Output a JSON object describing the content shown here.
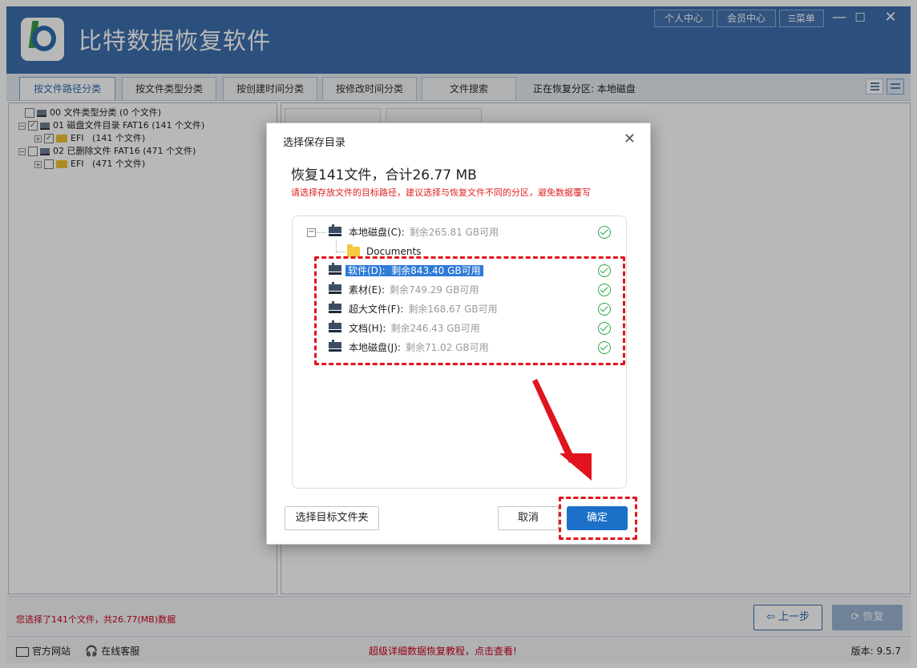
{
  "app": {
    "title": "比特数据恢复软件",
    "top_buttons": [
      "个人中心",
      "会员中心",
      "菜单"
    ],
    "brand_color": "#3d6fae"
  },
  "tabs": [
    {
      "label": "按文件路径分类",
      "active": true
    },
    {
      "label": "按文件类型分类",
      "active": false
    },
    {
      "label": "按创建时间分类",
      "active": false
    },
    {
      "label": "按修改时间分类",
      "active": false
    },
    {
      "label": "文件搜索",
      "active": false
    }
  ],
  "recovering_partition": "正在恢复分区: 本地磁盘",
  "tree": [
    {
      "prefix": "00",
      "label": "文件类型分类",
      "count": "(0 个文件)"
    },
    {
      "prefix": "01",
      "label": "磁盘文件目录 FAT16",
      "count": "(141 个文件)"
    },
    {
      "prefix": "",
      "label": "EFI",
      "count": "(141 个文件)"
    },
    {
      "prefix": "02",
      "label": "已删除文件 FAT16",
      "count": "(471 个文件)"
    },
    {
      "prefix": "",
      "label": "EFI",
      "count": "(471 个文件)"
    }
  ],
  "status": {
    "selection_text": "您选择了141个文件，共26.77(MB)数据",
    "prev_label": "上一步",
    "recover_label": "恢复"
  },
  "footer": {
    "website": "官方网站",
    "support": "在线客服",
    "tutorial": "超级详细数据恢复教程，点击查看!",
    "version": "版本: 9.5.7"
  },
  "dialog": {
    "title": "选择保存目录",
    "heading": "恢复141文件，合计26.77 MB",
    "hint": "请选择存放文件的目标路径，建议选择与恢复文件不同的分区，避免数据覆写",
    "drives": [
      {
        "name": "本地磁盘(C):",
        "free": "剩余265.81 GB可用"
      },
      {
        "name": "软件(D):",
        "free": "剩余843.40 GB可用",
        "selected": true
      },
      {
        "name": "素材(E):",
        "free": "剩余749.29 GB可用"
      },
      {
        "name": "超大文件(F):",
        "free": "剩余168.67 GB可用"
      },
      {
        "name": "文档(H):",
        "free": "剩余246.43 GB可用"
      },
      {
        "name": "本地磁盘(J):",
        "free": "剩余71.02 GB可用"
      }
    ],
    "subfolder": "Documents",
    "choose_folder_label": "选择目标文件夹",
    "cancel_label": "取消",
    "ok_label": "确定"
  }
}
